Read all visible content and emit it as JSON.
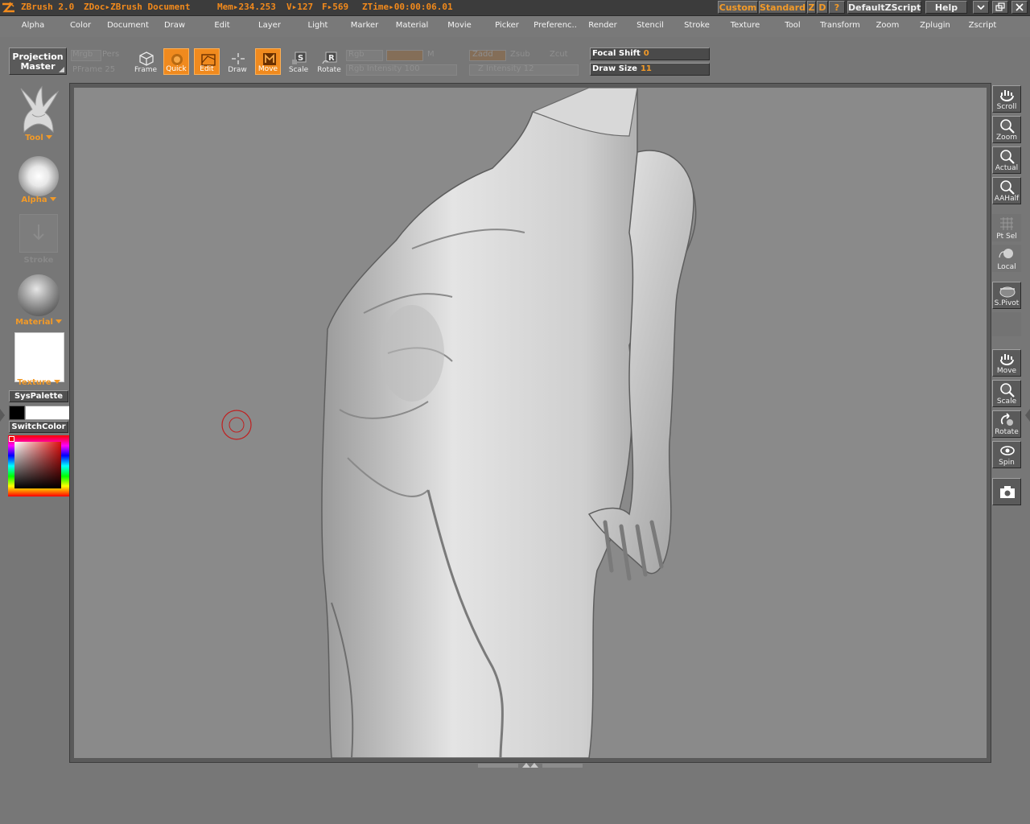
{
  "titlebar": {
    "app_name": "ZBrush 2.0",
    "doc_name": "ZDoc▸ZBrush Document",
    "mem": "Mem▸234.253",
    "verts": "V▸127",
    "faces": "F▸569",
    "ztime": "ZTime▸00:00:06.01",
    "buttons": {
      "custom": "Custom",
      "standard": "Standard",
      "z": "Z",
      "d": "D",
      "question": "?",
      "default_zscript": "DefaultZScript",
      "help": "Help"
    }
  },
  "menubar": {
    "items": [
      "Alpha",
      "Color",
      "Document",
      "Draw",
      "Edit",
      "Layer",
      "Light",
      "Marker",
      "Material",
      "Movie",
      "Picker",
      "Preferenc..",
      "Render",
      "Stencil",
      "Stroke",
      "Texture",
      "Tool",
      "Transform",
      "Zoom",
      "Zplugin",
      "Zscript"
    ]
  },
  "shelf": {
    "projection_master": "Projection Master",
    "disabled": {
      "mrgb": "Mrgb",
      "pers": "Pers",
      "pframe": "PFrame 25",
      "rgb": "Rgb",
      "m": "M",
      "rgb_intensity": "Rgb Intensity 100",
      "zadd": "Zadd",
      "zsub": "Zsub",
      "zcut": "Zcut",
      "z_intensity": "Z Intensity 12"
    },
    "tools": {
      "frame": "Frame",
      "quick": "Quick",
      "edit": "Edit",
      "draw": "Draw",
      "move": "Move",
      "scale": "Scale",
      "rotate": "Rotate"
    },
    "sliders": {
      "focal_shift": {
        "label": "Focal Shift",
        "value": "0"
      },
      "draw_size": {
        "label": "Draw Size",
        "value": "11"
      }
    }
  },
  "left_palette": {
    "tool": "Tool",
    "alpha": "Alpha",
    "stroke": "Stroke",
    "material": "Material",
    "texture": "Texture",
    "syspalette": "SysPalette",
    "switchcolor": "SwitchColor"
  },
  "right_palette": {
    "scroll": "Scroll",
    "zoom": "Zoom",
    "actual": "Actual",
    "aahalf": "AAHalf",
    "ptsel": "Pt Sel",
    "local": "Local",
    "spivot": "S.Pivot",
    "move": "Move",
    "scale": "Scale",
    "rotate": "Rotate",
    "spin": "Spin"
  },
  "colors": {
    "accent": "#f29a28",
    "title_text": "#f28a1c",
    "canvas_bg": "#8a8a8a",
    "ui_bg": "#777777",
    "brush_cursor": "#c02020"
  }
}
